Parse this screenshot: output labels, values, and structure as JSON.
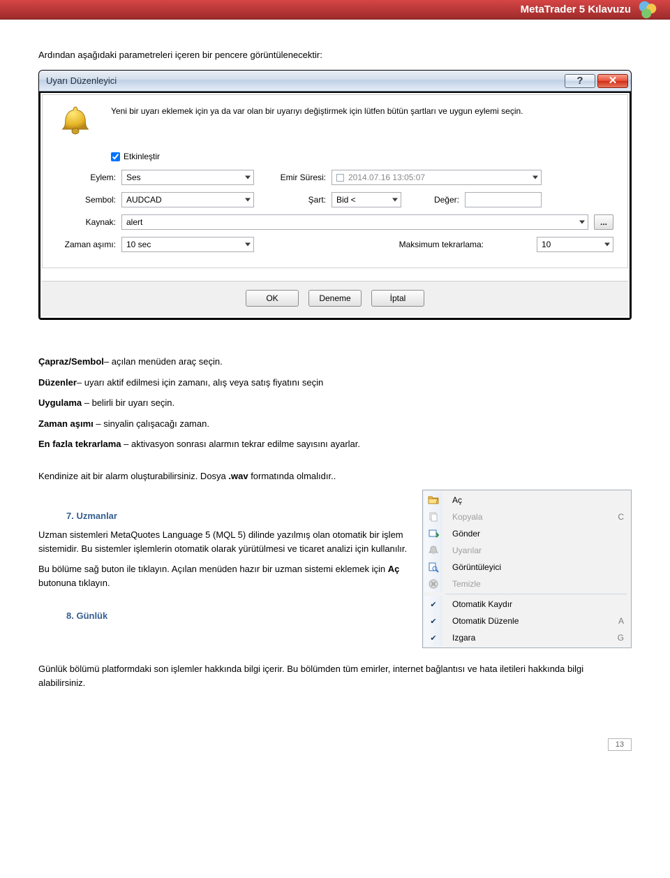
{
  "banner": {
    "title": "MetaTrader 5 Kılavuzu"
  },
  "intro": "Ardından aşağıdaki parametreleri içeren bir pencere görüntülenecektir:",
  "dialog": {
    "title": "Uyarı Düzenleyici",
    "help_glyph": "?",
    "close_glyph": "✕",
    "desc": "Yeni bir uyarı eklemek için ya da var olan bir uyarıyı değiştirmek için lütfen bütün şartları ve uygun eylemi seçin.",
    "enable_label": "Etkinleştir",
    "labels": {
      "eylem": "Eylem:",
      "emir": "Emir Süresi:",
      "sembol": "Sembol:",
      "sart": "Şart:",
      "deger": "Değer:",
      "kaynak": "Kaynak:",
      "zaman": "Zaman aşımı:",
      "maks": "Maksimum tekrarlama:"
    },
    "values": {
      "eylem": "Ses",
      "emir": "2014.07.16 13:05:07",
      "sembol": "AUDCAD",
      "sart": "Bid <",
      "deger": "",
      "kaynak": "alert",
      "zaman": "10 sec",
      "maks": "10"
    },
    "dots": "...",
    "buttons": {
      "ok": "OK",
      "deneme": "Deneme",
      "iptal": "İptal"
    }
  },
  "body": {
    "p1_bold": "Çapraz/Sembol",
    "p1_rest": "– açılan menüden araç seçin.",
    "p2_bold": "Düzenler",
    "p2_rest": "– uyarı aktif edilmesi için  zamanı, alış veya satış fiyatını seçin",
    "p3_bold": "Uygulama",
    "p3_rest": " – belirli bir uyarı seçin.",
    "p4_bold": "Zaman aşımı",
    "p4_rest": " – sinyalin çalışacağı zaman.",
    "p5_bold": "En fazla tekrarlama",
    "p5_rest": " – aktivasyon sonrası alarmın tekrar edilme sayısını ayarlar.",
    "p6a": "Kendinize ait bir alarm oluşturabilirsiniz. Dosya ",
    "p6b": ".wav",
    "p6c": " formatında olmalıdır.."
  },
  "section7": {
    "heading": "7.    Uzmanlar",
    "p1": "Uzman sistemleri MetaQuotes Language 5 (MQL 5) dilinde yazılmış olan otomatik bir işlem sistemidir. Bu sistemler işlemlerin otomatik olarak yürütülmesi ve ticaret analizi için kullanılır.",
    "p2a": "Bu bölüme sağ buton ile tıklayın. Açılan menüden hazır bir uzman sistemi eklemek için ",
    "p2b": "Aç",
    "p2c": " butonuna tıklayın."
  },
  "section8": {
    "heading": "8.    Günlük",
    "p1": "Günlük bölümü platformdaki son işlemler hakkında bilgi içerir. Bu bölümden tüm emirler, internet bağlantısı ve hata iletileri hakkında bilgi alabilirsiniz."
  },
  "menu": {
    "items": [
      {
        "label": "Aç",
        "type": "folder",
        "shortcut": "",
        "enabled": true
      },
      {
        "label": "Kopyala",
        "type": "copy",
        "shortcut": "C",
        "enabled": false
      },
      {
        "label": "Gönder",
        "type": "send",
        "shortcut": "",
        "enabled": true
      },
      {
        "label": "Uyarılar",
        "type": "bell",
        "shortcut": "",
        "enabled": false
      },
      {
        "label": "Görüntüleyici",
        "type": "viewer",
        "shortcut": "",
        "enabled": true
      },
      {
        "label": "Temizle",
        "type": "clear",
        "shortcut": "",
        "enabled": false
      }
    ],
    "items2": [
      {
        "label": "Otomatik Kaydır",
        "checked": true,
        "shortcut": ""
      },
      {
        "label": "Otomatik Düzenle",
        "checked": true,
        "shortcut": "A"
      },
      {
        "label": "Izgara",
        "checked": true,
        "shortcut": "G"
      }
    ]
  },
  "page_number": "13"
}
